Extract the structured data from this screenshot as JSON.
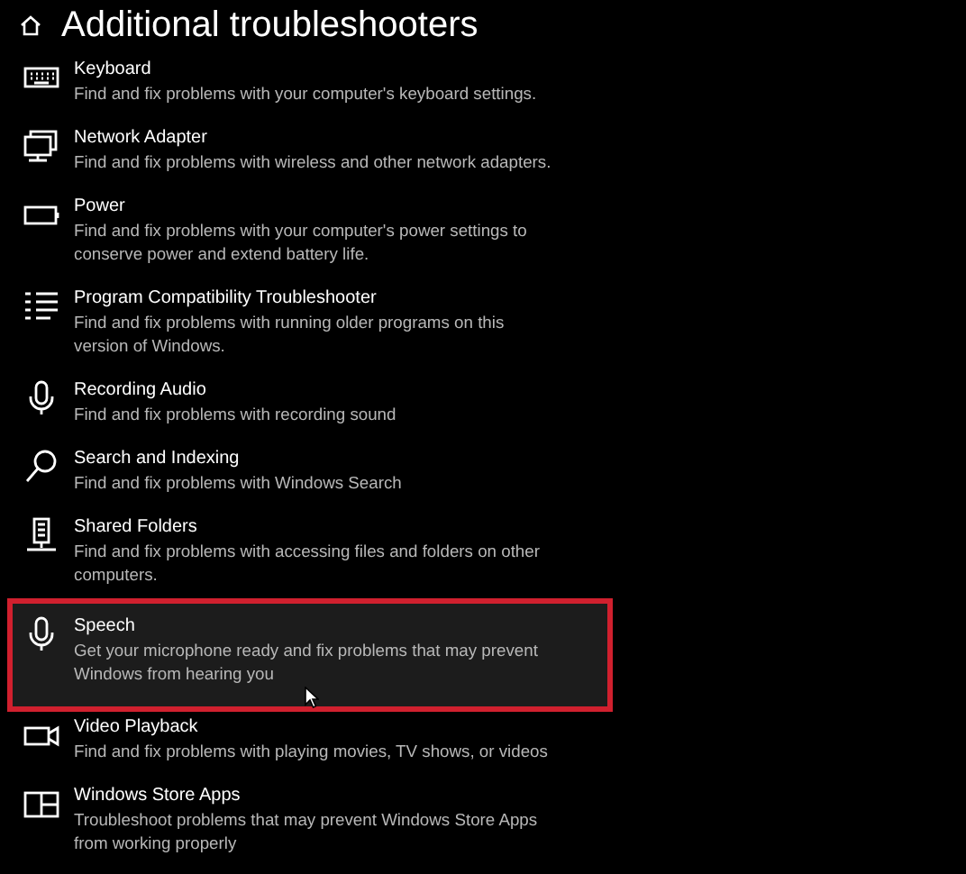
{
  "page": {
    "title": "Additional troubleshooters"
  },
  "troubleshooters": [
    {
      "kind": "keyboard",
      "name": "Keyboard",
      "description": [
        "Find and fix problems with your computer's keyboard settings."
      ],
      "selected": false
    },
    {
      "kind": "network",
      "name": "Network Adapter",
      "description": [
        "Find and fix problems with wireless and other network adapters."
      ],
      "selected": false
    },
    {
      "kind": "power",
      "name": "Power",
      "description": [
        "Find and fix problems with your computer's power settings to",
        "conserve power and extend battery life."
      ],
      "selected": false
    },
    {
      "kind": "list",
      "name": "Program Compatibility Troubleshooter",
      "description": [
        "Find and fix problems with running older programs on this",
        "version of Windows."
      ],
      "selected": false
    },
    {
      "kind": "mic",
      "name": "Recording Audio",
      "description": [
        "Find and fix problems with recording sound"
      ],
      "selected": false
    },
    {
      "kind": "search",
      "name": "Search and Indexing",
      "description": [
        "Find and fix problems with Windows Search"
      ],
      "selected": false
    },
    {
      "kind": "server",
      "name": "Shared Folders",
      "description": [
        "Find and fix problems with accessing files and folders on other",
        "computers."
      ],
      "selected": false
    },
    {
      "kind": "mic",
      "name": "Speech",
      "description": [
        "Get your microphone ready and fix problems that may prevent",
        "Windows from hearing you"
      ],
      "selected": true
    },
    {
      "kind": "video",
      "name": "Video Playback",
      "description": [
        "Find and fix problems with playing movies, TV shows, or videos"
      ],
      "selected": false
    },
    {
      "kind": "store",
      "name": "Windows Store Apps",
      "description": [
        "Troubleshoot problems that may prevent Windows Store Apps",
        "from working properly"
      ],
      "selected": false
    }
  ]
}
